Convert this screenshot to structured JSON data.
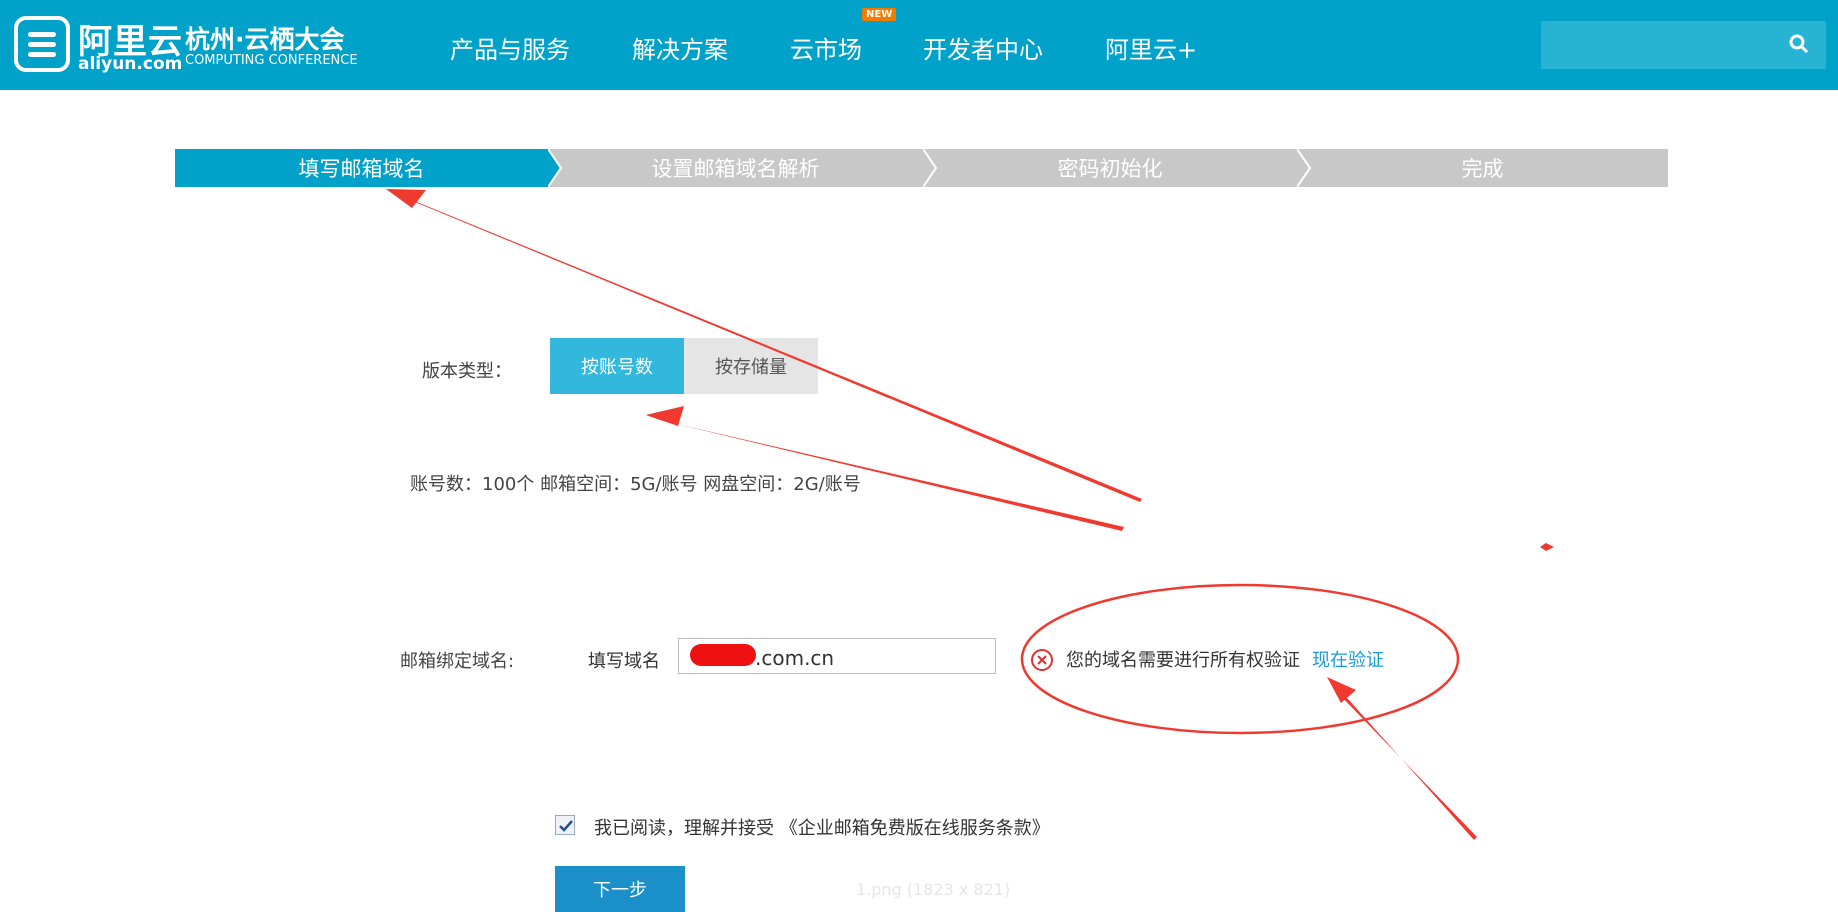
{
  "header": {
    "brand": "阿里云",
    "brand_sub": "aliyun.com",
    "conference": "杭州·云栖大会",
    "conference_sub": "COMPUTING CONFERENCE",
    "nav": [
      "产品与服务",
      "解决方案",
      "云市场",
      "开发者中心",
      "阿里云+"
    ],
    "new_badge": "NEW",
    "search_placeholder": "",
    "accent_color": "#00a2ca"
  },
  "steps": [
    "填写邮箱域名",
    "设置邮箱域名解析",
    "密码初始化",
    "完成"
  ],
  "form": {
    "version_label": "版本类型：",
    "version_options": [
      "按账号数",
      "按存储量"
    ],
    "version_selected": "按账号数",
    "quota_info": "账号数：100个  邮箱空间：5G/账号  网盘空间：2G/账号",
    "domain_label": "邮箱绑定域名:",
    "domain_field_label": "填写域名",
    "domain_value": ".com.cn",
    "error_text": "您的域名需要进行所有权验证",
    "verify_link": "现在验证",
    "agreement": "我已阅读，理解并接受 《企业邮箱免费版在线服务条款》",
    "agreement_checked": true,
    "next_button": "下一步"
  },
  "watermark": "1.png (1823 x 821)",
  "icons": [
    "aliyun-logo-icon",
    "search-icon",
    "error-circle-icon",
    "checkbox-check-icon"
  ]
}
